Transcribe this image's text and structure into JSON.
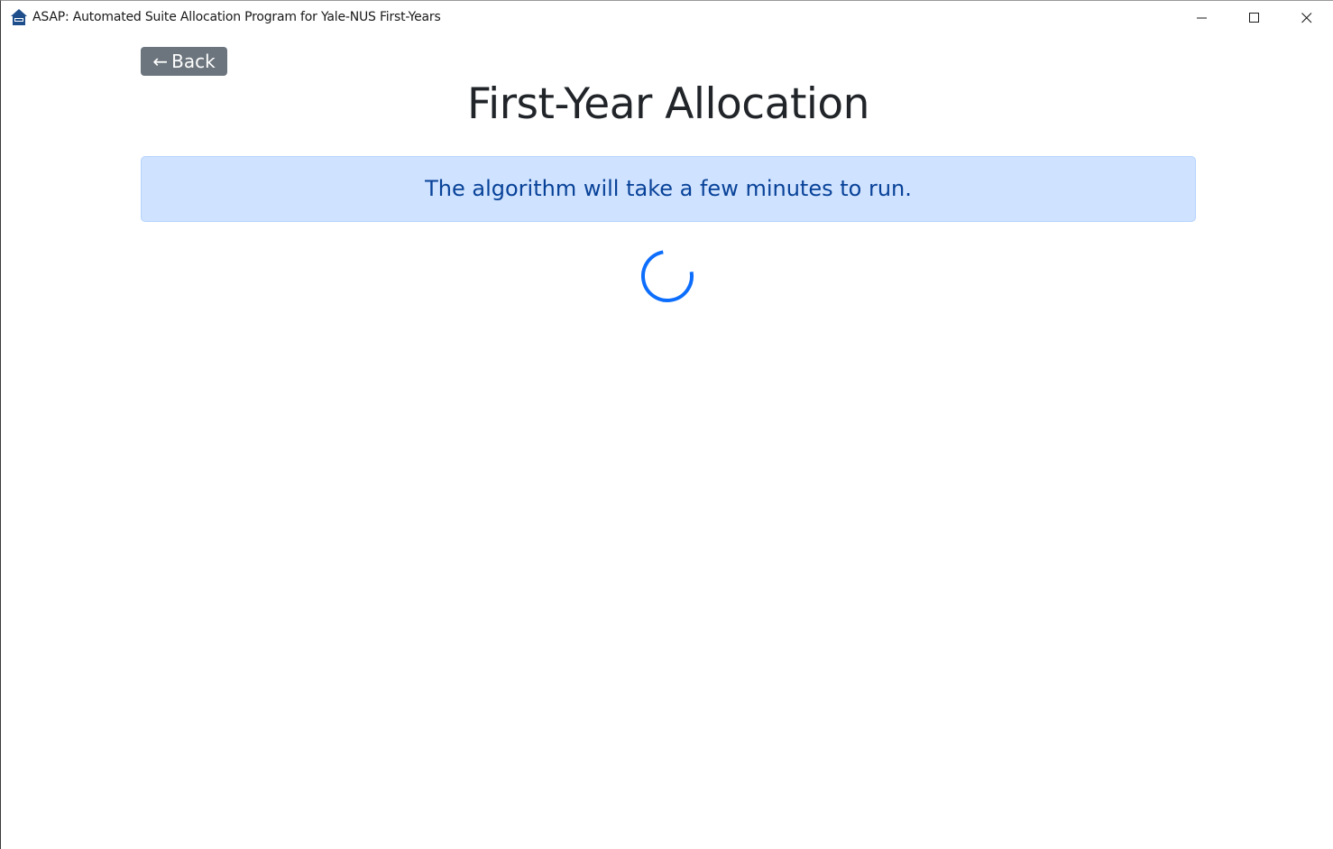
{
  "window": {
    "title": "ASAP: Automated Suite Allocation Program for Yale-NUS First-Years",
    "app_icon": "house-icon",
    "controls": [
      "minimize-icon",
      "maximize-icon",
      "close-icon"
    ]
  },
  "nav": {
    "back_arrow": "←",
    "back_label": "Back"
  },
  "main": {
    "title": "First-Year Allocation",
    "alert_text": "The algorithm will take a few minutes to run.",
    "spinner_icon": "loading-spinner-icon"
  },
  "colors": {
    "back_button_bg": "#6c757d",
    "alert_bg": "#cfe2ff",
    "alert_text": "#084298",
    "spinner": "#0d6efd",
    "title_text": "#212529"
  }
}
